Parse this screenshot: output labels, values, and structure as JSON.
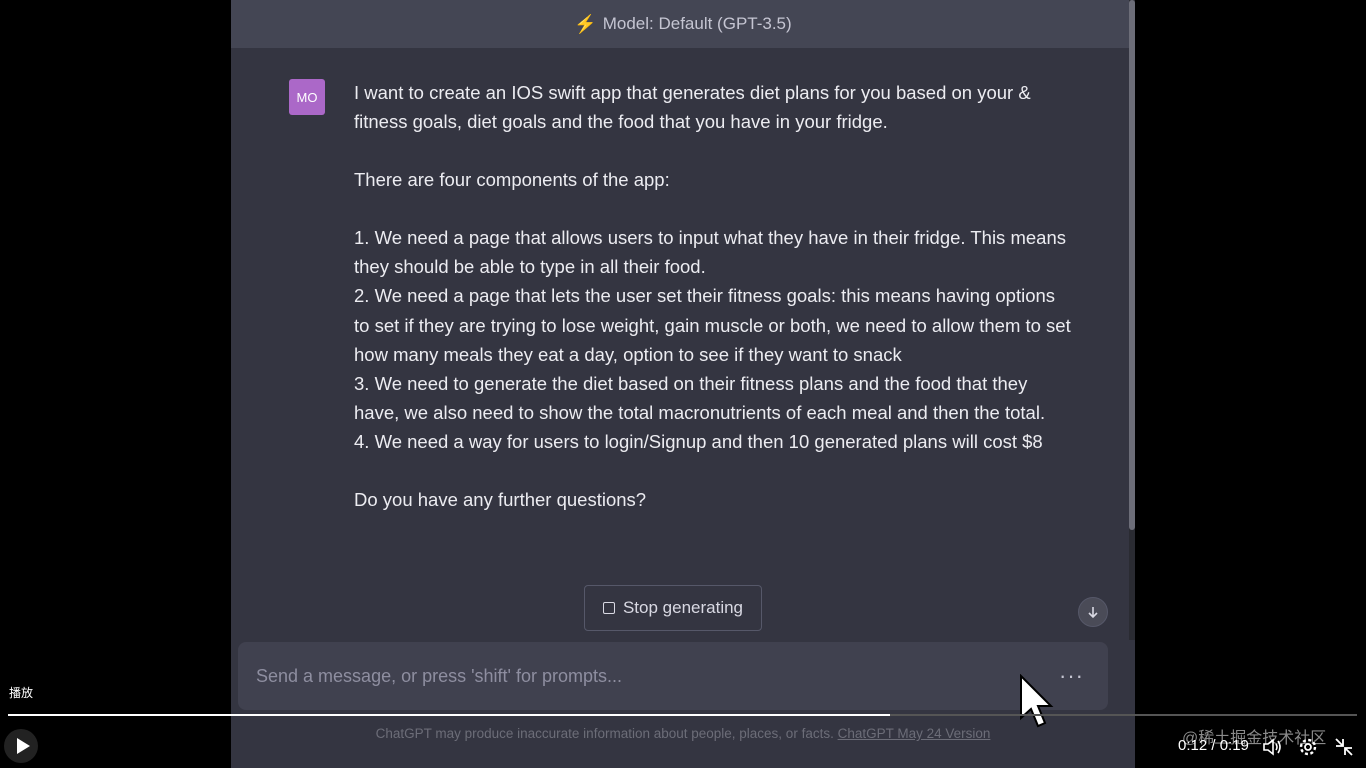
{
  "model_bar": {
    "label": "Model: Default (GPT-3.5)"
  },
  "message": {
    "avatar": "MO",
    "paragraphs": [
      "I want to create an IOS swift app that generates diet plans for you based on your & fitness goals, diet goals and the food that you have in your fridge.",
      "There are four components of the app:",
      "1. We need a page that allows users to input what they have in their fridge. This means they should be able to type in all their food.",
      "2. We need a page that lets the user set their fitness goals: this means having options to set if they are trying to lose weight, gain muscle or both, we need to allow them to set how many meals they eat a day, option to see if they want to snack",
      "3. We need to generate the diet based on their fitness plans and the food that they have, we also need to show the total macronutrients of each meal and then the total.",
      "4. We need a way for users to login/Signup and then 10 generated plans will cost $8",
      "Do you have any further questions?"
    ]
  },
  "stop_button": {
    "label": "Stop generating"
  },
  "composer": {
    "placeholder": "Send a message, or press 'shift' for prompts...",
    "more": "···"
  },
  "disclaimer": {
    "text": "ChatGPT may produce inaccurate information about people, places, or facts.",
    "link": "ChatGPT May 24 Version"
  },
  "video": {
    "play_label": "播放",
    "time": "0:12 / 0:19",
    "progress": 0.654,
    "watermark": "@稀土掘金技术社区"
  },
  "icons": {
    "model": "lightning-icon",
    "scroll": "arrow-down-icon",
    "play": "play-icon",
    "volume": "volume-icon",
    "settings": "gear-icon",
    "exit_fullscreen": "exit-fullscreen-icon"
  }
}
